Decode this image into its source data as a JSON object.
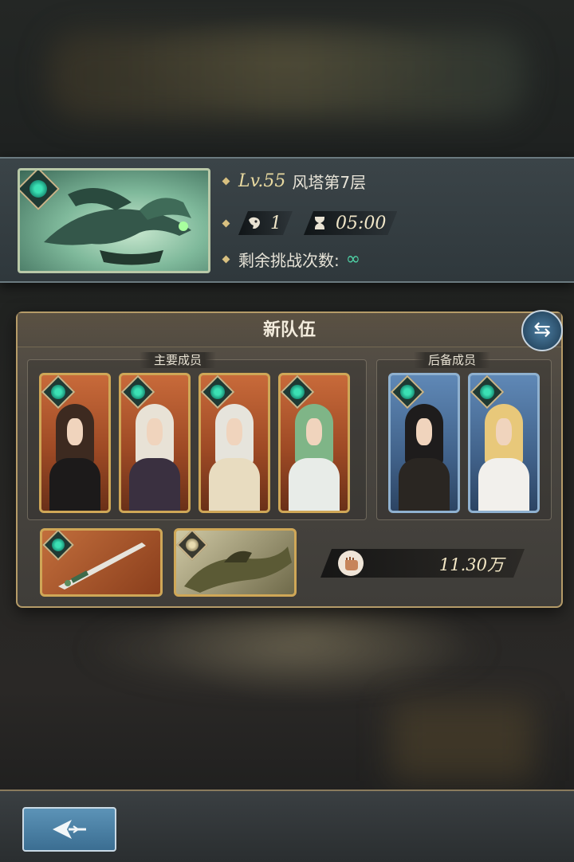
{
  "stage": {
    "level": "Lv.55",
    "name": "风塔第7层",
    "enemy_count": "1",
    "time": "05:00",
    "remaining_label": "剩余挑战次数:",
    "remaining_value": "∞",
    "element_icon": "wind-element-icon"
  },
  "team": {
    "title": "新队伍",
    "main_label": "主要成员",
    "backup_label": "后备成员",
    "main_members": [
      {
        "hair": "#3d2a20",
        "body": "#1c1a1a"
      },
      {
        "hair": "#e8e2d6",
        "body": "#3a3040"
      },
      {
        "hair": "#e6e4dc",
        "body": "#e8dcc0"
      },
      {
        "hair": "#7fb587",
        "body": "#e8ece8"
      }
    ],
    "backup_members": [
      {
        "hair": "#1e1c1c",
        "body": "#2a2622"
      },
      {
        "hair": "#e8c87a",
        "body": "#f2f0ec"
      }
    ],
    "power": "11.30万"
  },
  "colors": {
    "accent_gold": "#cfa757",
    "wind_green": "#3be0b4"
  }
}
